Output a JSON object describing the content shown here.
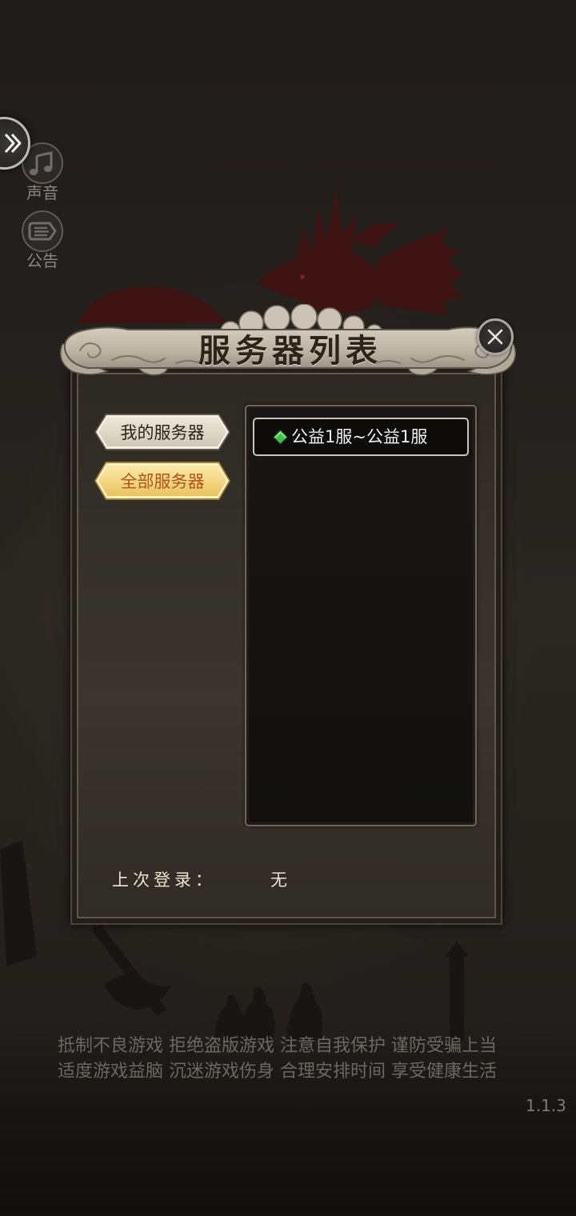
{
  "side_menu": {
    "collapse_icon": "double-chevron-icon",
    "sound": {
      "icon": "music-note-icon",
      "label": "声音"
    },
    "notice": {
      "icon": "announcement-list-icon",
      "label": "公告"
    }
  },
  "dialog": {
    "title": "服务器列表",
    "close_icon": "close-icon",
    "tabs": [
      {
        "label": "我的服务器",
        "selected": false
      },
      {
        "label": "全部服务器",
        "selected": true
      }
    ],
    "servers": [
      {
        "name": "公益1服~公益1服",
        "status_icon": "green-diamond-icon",
        "status_color": "#3fc24c"
      }
    ],
    "last_login": {
      "label": "上次登录：",
      "value": "无"
    }
  },
  "health_notice": {
    "line1": "抵制不良游戏 拒绝盗版游戏 注意自我保护 谨防受骗上当",
    "line2": "适度游戏益脑 沉迷游戏伤身 合理安排时间 享受健康生活"
  },
  "version": "1.1.3",
  "colors": {
    "background": "#1d1b18",
    "tab_fill": "#e6e0d2",
    "selected_tab_fill": "#f3d98a",
    "selected_tab_text": "#b2531a",
    "dragon_accent": "#3f1313"
  }
}
